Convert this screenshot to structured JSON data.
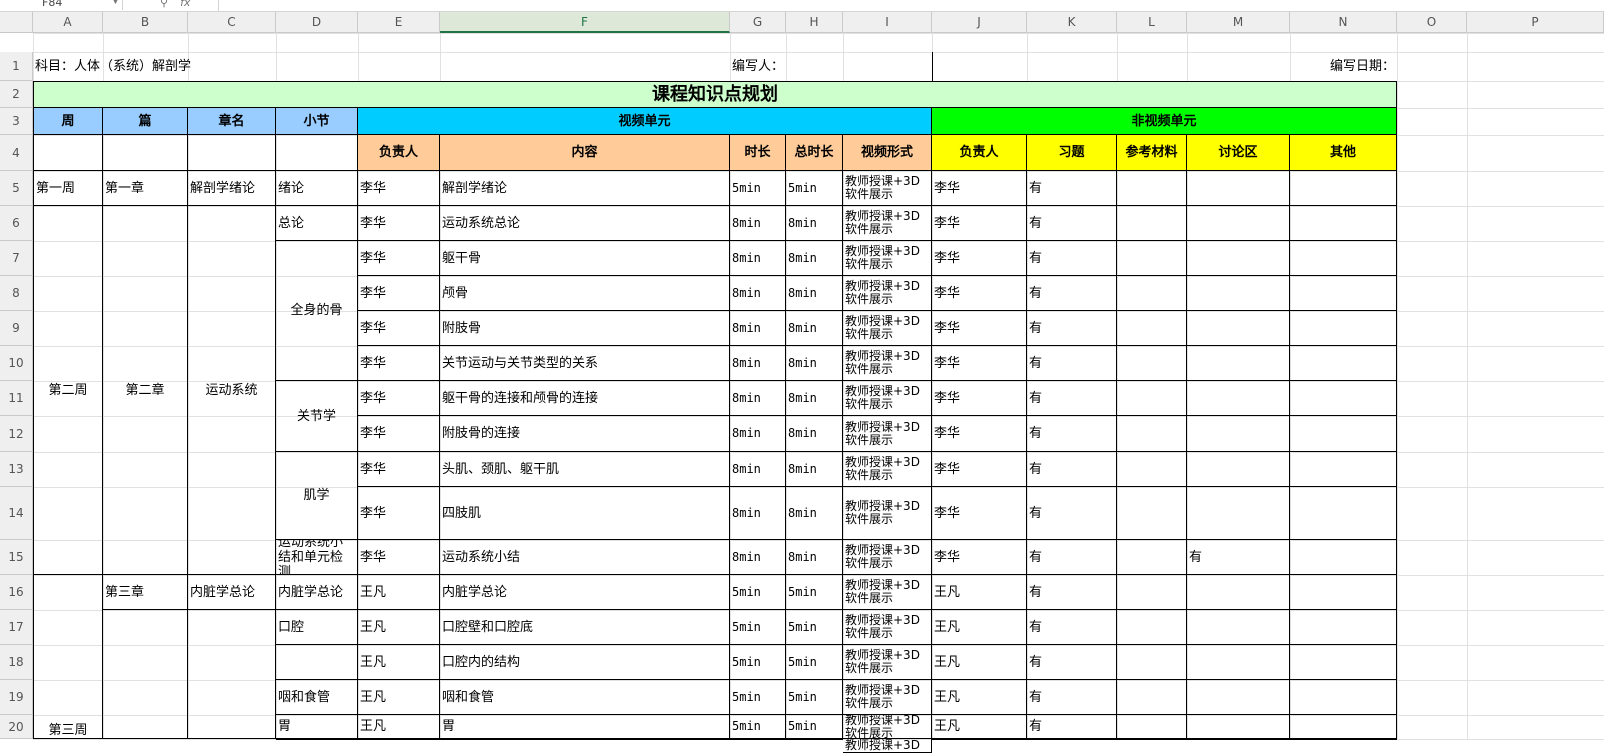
{
  "formula_bar": {
    "name_box": "F84",
    "fx_label": "fx",
    "formula": ""
  },
  "column_headers": [
    "A",
    "B",
    "C",
    "D",
    "E",
    "F",
    "G",
    "H",
    "I",
    "J",
    "K",
    "L",
    "M",
    "N",
    "O",
    "P"
  ],
  "row_headers": [
    "1",
    "2",
    "3",
    "4",
    "5",
    "6",
    "7",
    "8",
    "9",
    "10",
    "11",
    "12",
    "13",
    "14",
    "15",
    "16",
    "17",
    "18",
    "19",
    "20"
  ],
  "sheet": {
    "subject_label": "科目：人体（系统）解剖学",
    "author_label": "编写人：",
    "date_label": "编写日期：",
    "title": "课程知识点规划",
    "h_week": "周",
    "h_part": "篇",
    "h_chapter": "章名",
    "h_section": "小节",
    "h_video_unit": "视频单元",
    "h_nonvideo_unit": "非视频单元",
    "h_owner": "负责人",
    "h_content": "内容",
    "h_duration": "时长",
    "h_total": "总时长",
    "h_format": "视频形式",
    "h_owner2": "负责人",
    "h_exercise": "习题",
    "h_reference": "参考材料",
    "h_discussion": "讨论区",
    "h_other": "其他",
    "week1": "第一周",
    "week2": "第二周",
    "week3": "第三周",
    "part1": "第一章",
    "part2": "第二章",
    "part3": "第三章",
    "chap1": "解剖学绪论",
    "chap2": "运动系统",
    "chap3": "内脏学总论",
    "sec_intro": "绪论",
    "sec_general": "总论",
    "sec_bones": "全身的骨",
    "sec_joints": "关节学",
    "sec_muscles": "肌学",
    "sec_summary": "运动系统小结和单元检测",
    "sec_visceral": "内脏学总论",
    "sec_mouth": "口腔",
    "sec_pharynx": "咽和食管",
    "sec_stomach": "胃",
    "rows": [
      {
        "owner": "李华",
        "content": "解剖学绪论",
        "dur": "5min",
        "total": "5min",
        "format": "教师授课+3D软件展示",
        "owner2": "李华",
        "exercise": "有",
        "ref": "",
        "disc": "",
        "other": ""
      },
      {
        "owner": "李华",
        "content": "运动系统总论",
        "dur": "8min",
        "total": "8min",
        "format": "教师授课+3D软件展示",
        "owner2": "李华",
        "exercise": "有",
        "ref": "",
        "disc": "",
        "other": ""
      },
      {
        "owner": "李华",
        "content": "躯干骨",
        "dur": "8min",
        "total": "8min",
        "format": "教师授课+3D软件展示",
        "owner2": "李华",
        "exercise": "有",
        "ref": "",
        "disc": "",
        "other": ""
      },
      {
        "owner": "李华",
        "content": "颅骨",
        "dur": "8min",
        "total": "8min",
        "format": "教师授课+3D软件展示",
        "owner2": "李华",
        "exercise": "有",
        "ref": "",
        "disc": "",
        "other": ""
      },
      {
        "owner": "李华",
        "content": "附肢骨",
        "dur": "8min",
        "total": "8min",
        "format": "教师授课+3D软件展示",
        "owner2": "李华",
        "exercise": "有",
        "ref": "",
        "disc": "",
        "other": ""
      },
      {
        "owner": "李华",
        "content": "关节运动与关节类型的关系",
        "dur": "8min",
        "total": "8min",
        "format": "教师授课+3D软件展示",
        "owner2": "李华",
        "exercise": "有",
        "ref": "",
        "disc": "",
        "other": ""
      },
      {
        "owner": "李华",
        "content": "躯干骨的连接和颅骨的连接",
        "dur": "8min",
        "total": "8min",
        "format": "教师授课+3D软件展示",
        "owner2": "李华",
        "exercise": "有",
        "ref": "",
        "disc": "",
        "other": ""
      },
      {
        "owner": "李华",
        "content": "附肢骨的连接",
        "dur": "8min",
        "total": "8min",
        "format": "教师授课+3D软件展示",
        "owner2": "李华",
        "exercise": "有",
        "ref": "",
        "disc": "",
        "other": ""
      },
      {
        "owner": "李华",
        "content": "头肌、颈肌、躯干肌",
        "dur": "8min",
        "total": "8min",
        "format": "教师授课+3D软件展示",
        "owner2": "李华",
        "exercise": "有",
        "ref": "",
        "disc": "",
        "other": ""
      },
      {
        "owner": "李华",
        "content": "四肢肌",
        "dur": "8min",
        "total": "8min",
        "format": "教师授课+3D软件展示",
        "owner2": "李华",
        "exercise": "有",
        "ref": "",
        "disc": "",
        "other": ""
      },
      {
        "owner": "李华",
        "content": "运动系统小结",
        "dur": "8min",
        "total": "8min",
        "format": "教师授课+3D软件展示",
        "owner2": "李华",
        "exercise": "有",
        "ref": "",
        "disc": "有",
        "other": ""
      },
      {
        "owner": "王凡",
        "content": "内脏学总论",
        "dur": "5min",
        "total": "5min",
        "format": "教师授课+3D软件展示",
        "owner2": "王凡",
        "exercise": "有",
        "ref": "",
        "disc": "",
        "other": ""
      },
      {
        "owner": "王凡",
        "content": "口腔壁和口腔底",
        "dur": "5min",
        "total": "5min",
        "format": "教师授课+3D软件展示",
        "owner2": "王凡",
        "exercise": "有",
        "ref": "",
        "disc": "",
        "other": ""
      },
      {
        "owner": "王凡",
        "content": "口腔内的结构",
        "dur": "5min",
        "total": "5min",
        "format": "教师授课+3D软件展示",
        "owner2": "王凡",
        "exercise": "有",
        "ref": "",
        "disc": "",
        "other": ""
      },
      {
        "owner": "王凡",
        "content": "咽和食管",
        "dur": "5min",
        "total": "5min",
        "format": "教师授课+3D软件展示",
        "owner2": "王凡",
        "exercise": "有",
        "ref": "",
        "disc": "",
        "other": ""
      },
      {
        "owner": "王凡",
        "content": "胃",
        "dur": "5min",
        "total": "5min",
        "format": "教师授课+3D软件展示",
        "owner2": "王凡",
        "exercise": "有",
        "ref": "",
        "disc": "",
        "other": ""
      },
      {
        "owner": "",
        "content": "",
        "dur": "",
        "total": "",
        "format": "教师授课+3D",
        "owner2": "",
        "exercise": "",
        "ref": "",
        "disc": "",
        "other": ""
      }
    ]
  }
}
